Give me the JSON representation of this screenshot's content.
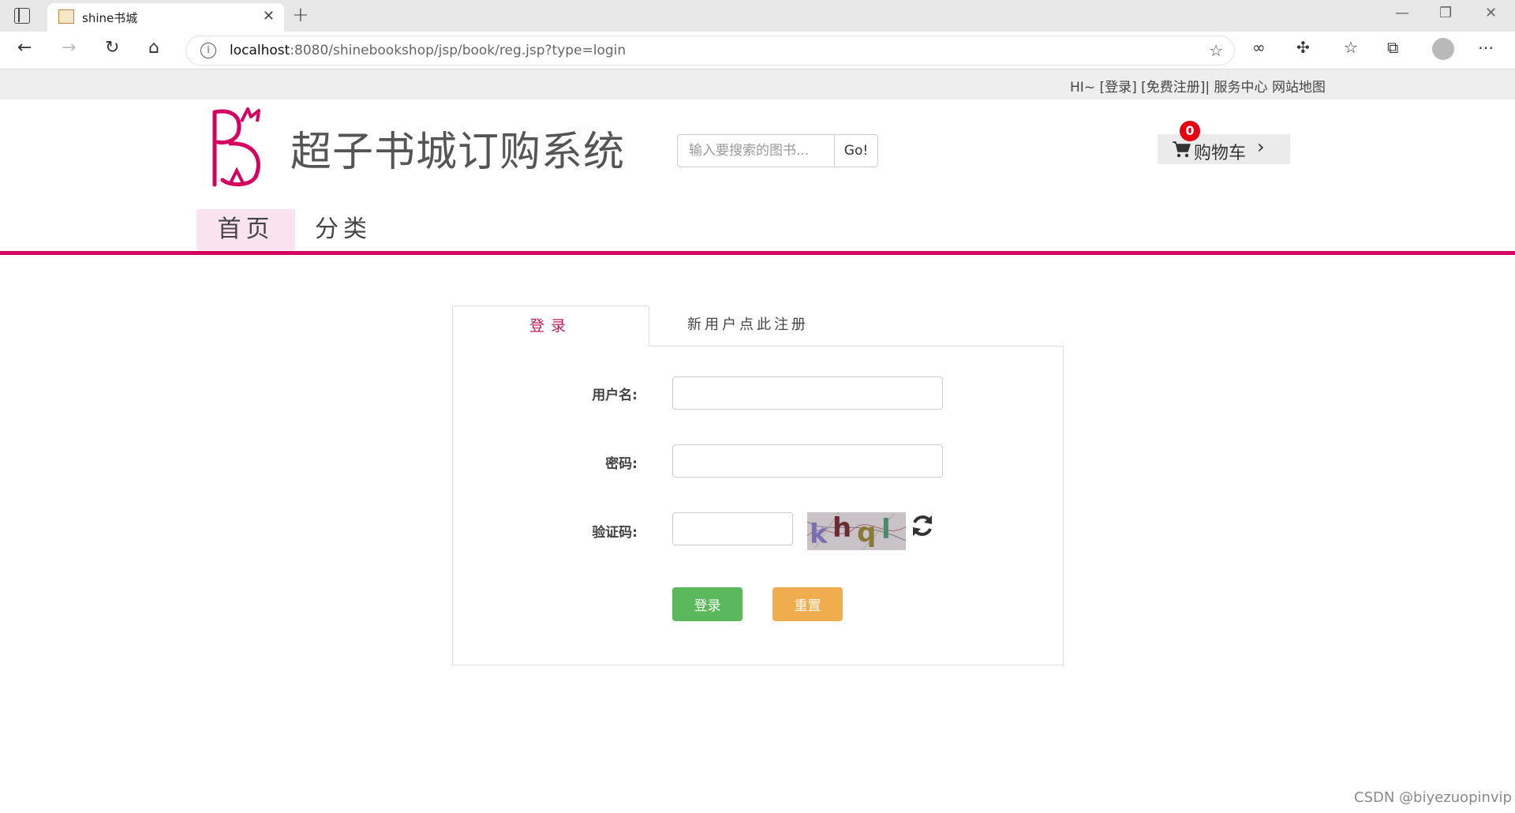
{
  "browser": {
    "tab_title": "shine书城",
    "url_host": "localhost",
    "url_path": ":8080/shinebookshop/jsp/book/reg.jsp?type=login"
  },
  "topbar": {
    "greeting": "HI~ ",
    "login_link": "[登录]",
    "register_link": "[免费注册]",
    "separator": "| ",
    "service_center": "服务中心",
    "sitemap": "网站地图"
  },
  "header": {
    "site_title": "超子书城订购系统",
    "search_placeholder": "输入要搜索的图书...",
    "search_button": "Go!",
    "cart_label": "购物车",
    "cart_count": "0"
  },
  "nav": {
    "home": "首页",
    "category": "分类"
  },
  "login": {
    "tab_login": "登录",
    "tab_register": "新用户点此注册",
    "username_label": "用户名:",
    "password_label": "密码:",
    "captcha_label": "验证码:",
    "captcha_text": [
      "k",
      "h",
      "q",
      "l"
    ],
    "login_button": "登录",
    "reset_button": "重置"
  },
  "watermark": "CSDN @biyezuopinvip",
  "colors": {
    "brand": "#d6005e",
    "login_green": "#5cb85c",
    "reset_orange": "#f0ad4e",
    "badge_red": "#e60012"
  }
}
